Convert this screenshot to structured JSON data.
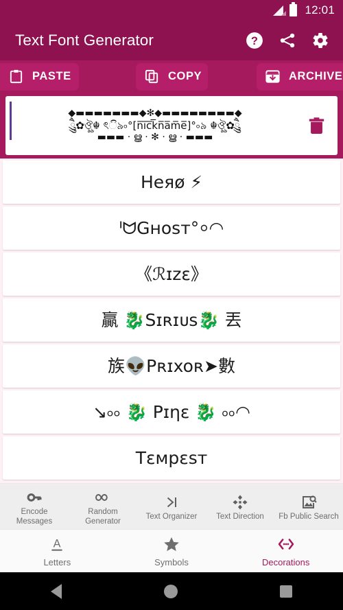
{
  "statusbar": {
    "time": "12:01",
    "signal_icon": "signal-bars-icon",
    "battery_icon": "battery-full-icon"
  },
  "appbar": {
    "title": "Text Font Generator",
    "actions": [
      {
        "name": "help-icon",
        "label": "Help"
      },
      {
        "name": "share-icon",
        "label": "Share"
      },
      {
        "name": "settings-gear-icon",
        "label": "Settings"
      }
    ]
  },
  "action_strip": {
    "paste_label": "PASTE",
    "copy_label": "COPY",
    "archive_label": "ARCHIVE"
  },
  "editor": {
    "line1": "◆▬▬▬▬▬▬▬◆✻◆▬▬▬▬▬▬▬▬◆",
    "line2": "ཻུུ✿ঔৣ☬ ৎි৯৹°[n̅i̅c̅k̅n̅a̅m̅e̅]°৹৯ ☬ঔৣ✿ཻུུ",
    "line3": "▬▬▬ · ൠ · ✻ · ൠ · ▬▬▬",
    "delete_icon": "trash-icon",
    "caret": "text-cursor"
  },
  "list": {
    "items": [
      {
        "text": "Heяø ⚡",
        "name": "font-style-card-hero"
      },
      {
        "text": "ᑊᗢGʜᴏsᴛ°⸰◠",
        "name": "font-style-card-ghost"
      },
      {
        "text": "《ℛɪzε》",
        "name": "font-style-card-rize"
      },
      {
        "text": "贏 🐉Sɪʀɪᴜs🐉 丟",
        "name": "font-style-card-sirius"
      },
      {
        "text": "族👽Pʀɪxoʀ➤數",
        "name": "font-style-card-prixor"
      },
      {
        "text": "↘৹৹ 🐉 Pɪηε 🐉 ৹৹◠",
        "name": "font-style-card-pine"
      },
      {
        "text": "Tεᴍpεsт",
        "name": "font-style-card-tempest"
      }
    ]
  },
  "feature_bar": {
    "items": [
      {
        "label": "Encode\nMessages",
        "icon": "key-icon",
        "name": "feature-encode-messages"
      },
      {
        "label": "Random\nGenerator",
        "icon": "infinity-icon",
        "name": "feature-random-generator"
      },
      {
        "label": "Text Organizer",
        "icon": "text-organizer-icon",
        "name": "feature-text-organizer"
      },
      {
        "label": "Text Direction",
        "icon": "move-arrows-icon",
        "name": "feature-text-direction"
      },
      {
        "label": "Fb Public Search",
        "icon": "image-search-icon",
        "name": "feature-fb-public-search"
      }
    ]
  },
  "tabbar": {
    "tabs": [
      {
        "label": "Letters",
        "icon": "letter-a-underline-icon",
        "active": false
      },
      {
        "label": "Symbols",
        "icon": "star-icon",
        "active": false
      },
      {
        "label": "Decorations",
        "icon": "angle-brackets-dots-icon",
        "active": true
      }
    ]
  },
  "navbar": {
    "back": "back-triangle-icon",
    "home": "home-circle-icon",
    "recents": "recents-square-icon"
  },
  "colors": {
    "status_bar": "#8e1150",
    "app_bar": "#8e1150",
    "action_strip": "#a5195d",
    "action_button": "#b51e68",
    "page_background": "#fdf1f6",
    "card": "#ffffff",
    "accent": "#a5195d",
    "feature_bar": "#eeeeee",
    "tab_bar": "#fafafa",
    "nav_bar": "#000000"
  }
}
